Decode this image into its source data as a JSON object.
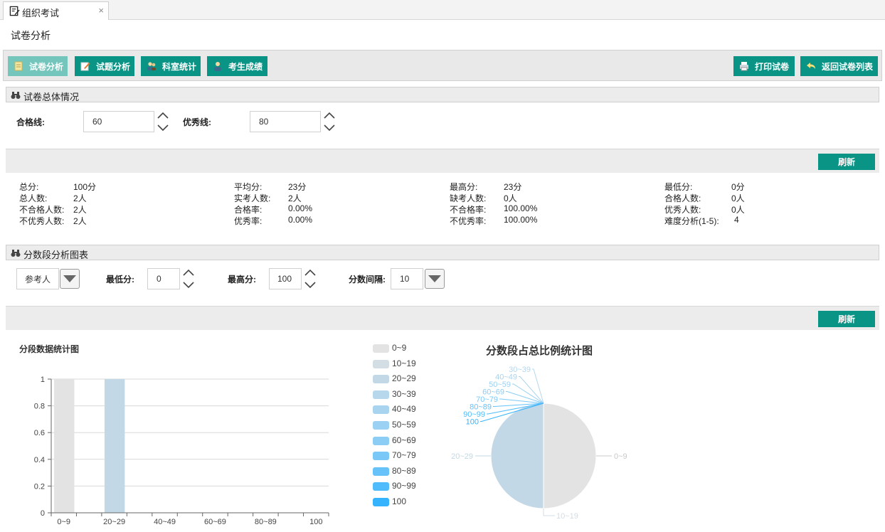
{
  "tab": {
    "label": "组织考试",
    "close": "×"
  },
  "page_title": "试卷分析",
  "toolbar": {
    "buttons": [
      {
        "label": "试卷分析"
      },
      {
        "label": "试题分析"
      },
      {
        "label": "科室统计"
      },
      {
        "label": "考生成绩"
      }
    ],
    "print_label": "打印试卷",
    "back_label": "返回试卷列表"
  },
  "overview": {
    "title": "试卷总体情况",
    "pass_label": "合格线:",
    "pass_value": "60",
    "excellent_label": "优秀线:",
    "excellent_value": "80",
    "refresh_label": "刷新",
    "stats": [
      [
        {
          "label": "总分:",
          "value": "100分"
        },
        {
          "label": "总人数:",
          "value": "2人"
        },
        {
          "label": "不合格人数:",
          "value": "2人"
        },
        {
          "label": "不优秀人数:",
          "value": "2人"
        }
      ],
      [
        {
          "label": "平均分:",
          "value": "23分"
        },
        {
          "label": "实考人数:",
          "value": "2人"
        },
        {
          "label": "合格率:",
          "value": "0.00%"
        },
        {
          "label": "优秀率:",
          "value": "0.00%"
        }
      ],
      [
        {
          "label": "最高分:",
          "value": "23分"
        },
        {
          "label": "缺考人数:",
          "value": "0人"
        },
        {
          "label": "不合格率:",
          "value": "100.00%"
        },
        {
          "label": "不优秀率:",
          "value": "100.00%"
        }
      ],
      [
        {
          "label": "最低分:",
          "value": "0分"
        },
        {
          "label": "合格人数:",
          "value": "0人"
        },
        {
          "label": "优秀人数:",
          "value": "0人"
        },
        {
          "label": "难度分析(1-5):",
          "value": "4"
        }
      ]
    ]
  },
  "score_section": {
    "title": "分数段分析图表",
    "select_value": "参考人",
    "min_label": "最低分:",
    "min_value": "0",
    "max_label": "最高分:",
    "max_value": "100",
    "interval_label": "分数间隔:",
    "interval_value": "10",
    "refresh_label": "刷新"
  },
  "colors": {
    "accent": "#0a9486",
    "accent_active": "#74c6bd"
  },
  "chart_data": [
    {
      "type": "bar",
      "title": "分段数据统计图",
      "categories": [
        "0~9",
        "10~19",
        "20~29",
        "30~39",
        "40~49",
        "50~59",
        "60~69",
        "70~79",
        "80~89",
        "90~99",
        "100"
      ],
      "x_tick_labels": [
        "0~9",
        "20~29",
        "40~49",
        "60~69",
        "80~89",
        "100"
      ],
      "values": [
        1,
        0,
        1,
        0,
        0,
        0,
        0,
        0,
        0,
        0,
        0
      ],
      "colors": [
        "#e3e3e3",
        "#d2dde4",
        "#c2d8e6"
      ],
      "ylim": [
        0,
        1
      ],
      "yticks": [
        "0",
        "0.2",
        "0.4",
        "0.6",
        "0.8",
        "1"
      ],
      "grid": true
    },
    {
      "type": "pie",
      "title": "分数段占总比例统计图",
      "labels": [
        "0~9",
        "10~19",
        "20~29",
        "30~39",
        "40~49",
        "50~59",
        "60~69",
        "70~79",
        "80~89",
        "90~99",
        "100"
      ],
      "values": [
        1,
        0,
        1,
        0,
        0,
        0,
        0,
        0,
        0,
        0,
        0
      ],
      "colors": [
        "#e3e3e3",
        "#d2dde4",
        "#c2d8e6",
        "#b6d7ec",
        "#a9d4ef",
        "#9bd1f2",
        "#8bcdf5",
        "#7ac8f7",
        "#66c2f9",
        "#50bcfb",
        "#35b4fd"
      ],
      "legend_position": "left"
    }
  ]
}
